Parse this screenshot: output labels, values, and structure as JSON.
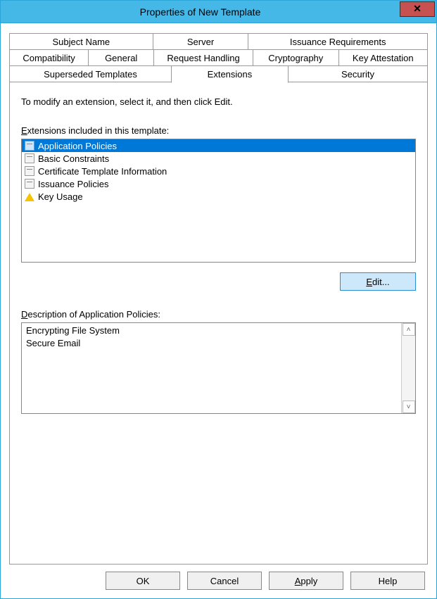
{
  "window": {
    "title": "Properties of New Template"
  },
  "tabs": {
    "row1": [
      "Subject Name",
      "Server",
      "Issuance Requirements"
    ],
    "row2": [
      "Compatibility",
      "General",
      "Request Handling",
      "Cryptography",
      "Key Attestation"
    ],
    "row3": [
      "Superseded Templates",
      "Extensions",
      "Security"
    ]
  },
  "body": {
    "instruction": "To modify an extension, select it, and then click Edit.",
    "extensions_label": "Extensions included in this template:",
    "extensions": [
      {
        "name": "Application Policies",
        "icon": "cert-icon",
        "selected": true
      },
      {
        "name": "Basic Constraints",
        "icon": "cert-icon",
        "selected": false
      },
      {
        "name": "Certificate Template Information",
        "icon": "cert-icon",
        "selected": false
      },
      {
        "name": "Issuance Policies",
        "icon": "cert-icon",
        "selected": false
      },
      {
        "name": "Key Usage",
        "icon": "warn-icon",
        "selected": false
      }
    ],
    "edit_label": "Edit...",
    "description_label": "Description of Application Policies:",
    "description_text": "Encrypting File System\nSecure Email"
  },
  "buttons": {
    "ok": "OK",
    "cancel": "Cancel",
    "apply": "Apply",
    "help": "Help"
  }
}
